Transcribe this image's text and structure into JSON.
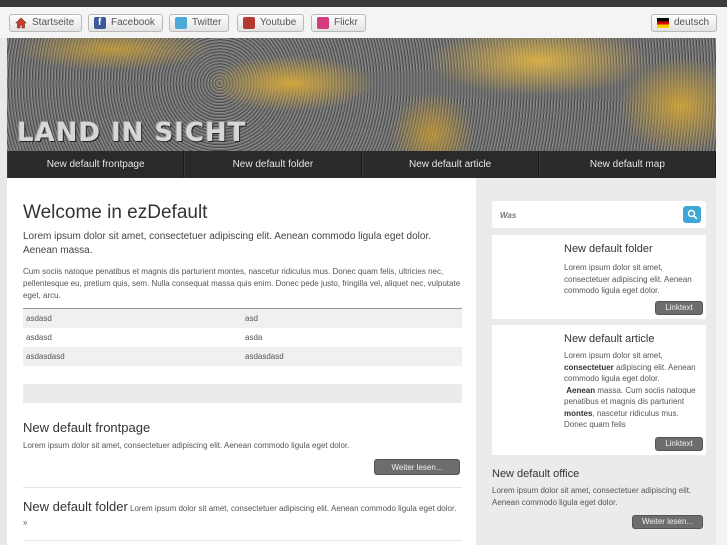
{
  "topbar": {
    "buttons": [
      {
        "label": "Startseite",
        "icon": "home-icon"
      },
      {
        "label": "Facebook",
        "icon": "facebook-icon"
      },
      {
        "label": "Twitter",
        "icon": "twitter-icon"
      },
      {
        "label": "Youtube",
        "icon": "youtube-icon"
      },
      {
        "label": "Flickr",
        "icon": "flickr-icon"
      }
    ],
    "language": {
      "label": "deutsch",
      "icon": "german-flag-icon"
    }
  },
  "banner": {
    "title": "LAND IN SICHT"
  },
  "nav": [
    "New default frontpage",
    "New default folder",
    "New default article",
    "New default map"
  ],
  "main": {
    "title": "Welcome in ezDefault",
    "lead": "Lorem ipsum dolor sit amet, consectetuer adipiscing elit. Aenean commodo ligula eget dolor. Aenean massa.",
    "body": "Cum sociis natoque penatibus et magnis dis parturient montes, nascetur ridiculus mus. Donec quam felis, ultricies nec, pellentesque eu, pretium quis, sem. Nulla consequat massa quis enim. Donec pede justo, fringilla vel, aliquet nec, vulputate eget, arcu.",
    "table": [
      [
        "asdasd",
        "asd"
      ],
      [
        "asdasd",
        "asda"
      ],
      [
        "asdasdasd",
        "asdasdasd"
      ]
    ],
    "frontpage": {
      "title": "New default frontpage",
      "text": "Lorem ipsum dolor sit amet, consectetuer adipiscing elit. Aenean commodo ligula eget dolor.",
      "button": "Weiter lesen..."
    },
    "folder": {
      "title": "New default folder",
      "text": "Lorem ipsum dolor sit amet, consectetuer adipiscing elit. Aenean commodo ligula eget dolor. »"
    }
  },
  "sidebar": {
    "search_placeholder": "Was",
    "folder": {
      "title": "New default folder",
      "text": "Lorem ipsum dolor sit amet, consectetuer adipiscing elit. Aenean commodo ligula eget dolor.",
      "button": "Linktext"
    },
    "article": {
      "title": "New default article",
      "text_1": "Lorem ipsum dolor sit amet, ",
      "bold_1": "consectetuer",
      "text_2": " adipiscing elit. Aenean commodo ligula eget dolor.",
      "bold_2": "Aenean",
      "text_3": " massa. Cum sociis natoque penatibus et magnis dis parturient ",
      "bold_3": "montes",
      "text_4": ", nascetur ridiculus mus. Donec quam felis",
      "button": "Linktext"
    },
    "office": {
      "title": "New default office",
      "text": "Lorem ipsum dolor sit amet, consectetuer adipiscing elit. Aenean commodo ligula eget dolor.",
      "button": "Weiter lesen..."
    }
  }
}
